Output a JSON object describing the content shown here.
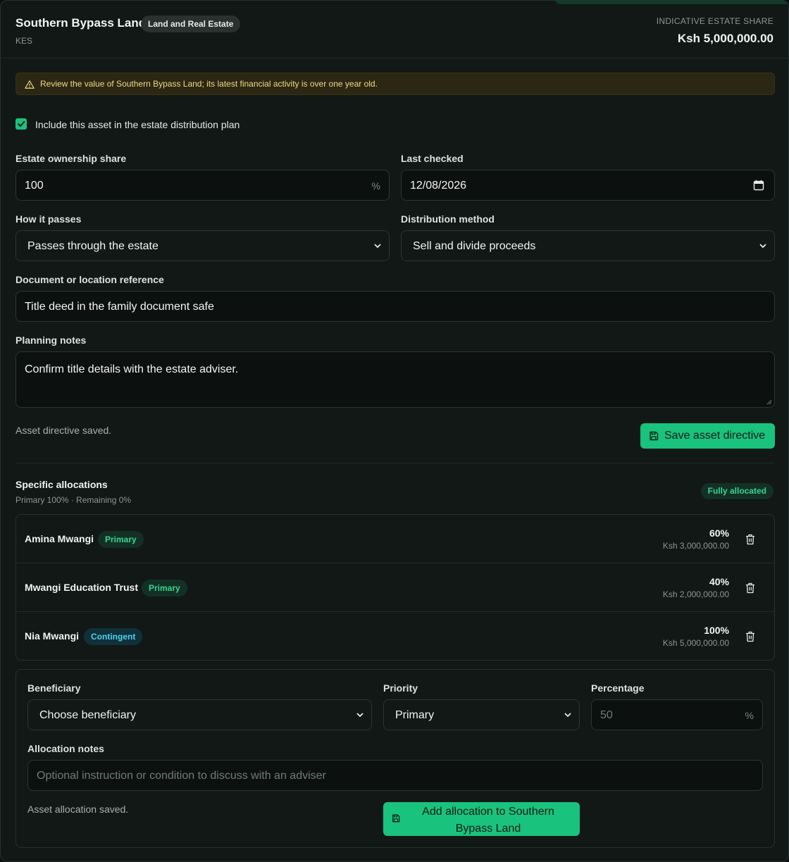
{
  "header": {
    "title": "Southern Bypass Land",
    "category": "Land and Real Estate",
    "currency": "KES",
    "estate_share_label": "INDICATIVE ESTATE SHARE",
    "estate_share_value": "Ksh 5,000,000.00"
  },
  "warning": {
    "text": "Review the value of Southern Bypass Land; its latest financial activity is over one year old."
  },
  "include": {
    "checked": true,
    "label": "Include this asset in the estate distribution plan"
  },
  "directive": {
    "ownership_label": "Estate ownership share",
    "ownership_value": "100",
    "ownership_suffix": "%",
    "last_checked_label": "Last checked",
    "last_checked_value": "12/08/2026",
    "passes_label": "How it passes",
    "passes_value": "Passes through the estate",
    "method_label": "Distribution method",
    "method_value": "Sell and divide proceeds",
    "reference_label": "Document or location reference",
    "reference_value": "Title deed in the family document safe",
    "notes_label": "Planning notes",
    "notes_value": "Confirm title details with the estate adviser.",
    "status": "Asset directive saved.",
    "save_label": "Save asset directive"
  },
  "allocations": {
    "title": "Specific allocations",
    "summary": "Primary 100% · Remaining 0%",
    "status_badge": "Fully allocated",
    "items": [
      {
        "name": "Amina Mwangi",
        "priority": "Primary",
        "percent": "60%",
        "amount": "Ksh 3,000,000.00"
      },
      {
        "name": "Mwangi Education Trust",
        "priority": "Primary",
        "percent": "40%",
        "amount": "Ksh 2,000,000.00"
      },
      {
        "name": "Nia Mwangi",
        "priority": "Contingent",
        "percent": "100%",
        "amount": "Ksh 5,000,000.00"
      }
    ]
  },
  "new_allocation": {
    "beneficiary_label": "Beneficiary",
    "beneficiary_value": "Choose beneficiary",
    "priority_label": "Priority",
    "priority_value": "Primary",
    "percentage_label": "Percentage",
    "percentage_placeholder": "50",
    "percentage_suffix": "%",
    "notes_label": "Allocation notes",
    "notes_placeholder": "Optional instruction or condition to discuss with an adviser",
    "status": "Asset allocation saved.",
    "add_label": "Add allocation to Southern Bypass Land"
  },
  "colors": {
    "accent": "#19c37d",
    "background": "#111816",
    "warning_bg": "#2b2712",
    "warning_text": "#f1d889",
    "primary_badge": "#35d68d",
    "contingent_badge": "#4fd2f0"
  },
  "icons": {
    "warning": "warning-triangle-icon",
    "checkbox": "check-icon",
    "select": "chevron-down-icon",
    "date": "calendar-icon",
    "save": "save-icon",
    "delete": "trash-icon"
  }
}
